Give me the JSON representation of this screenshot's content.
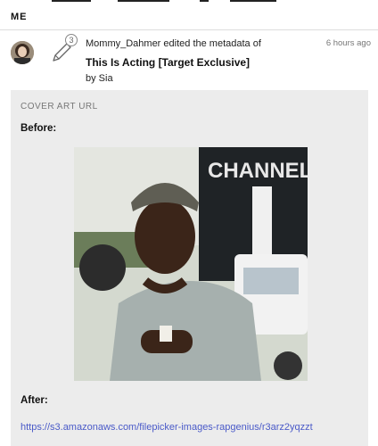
{
  "header": {
    "section_title": "ME"
  },
  "activity": {
    "username": "Mommy_Dahmer",
    "action_text": "edited the metadata of",
    "edit_count": "3",
    "timestamp": "6 hours ago",
    "song_title": "This Is Acting [Target Exclusive]",
    "artist_line": "by Sia"
  },
  "change": {
    "field_label": "COVER ART URL",
    "before_label": "Before:",
    "after_label": "After:",
    "after_url": "https://s3.amazonaws.com/filepicker-images-rapgenius/r3arz2yqzzt",
    "cover_sign_text": "CHANNEL"
  },
  "icons": {
    "avatar": "user-avatar",
    "edit": "pencil-icon"
  }
}
